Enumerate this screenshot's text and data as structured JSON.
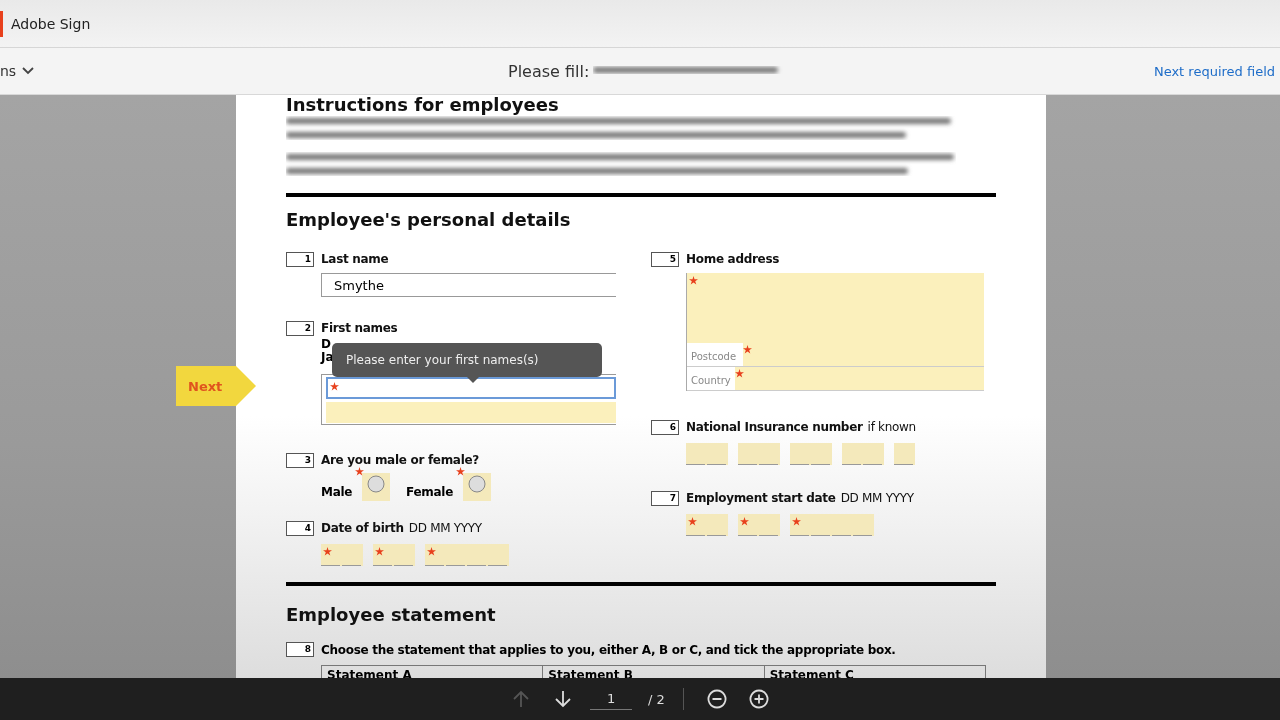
{
  "app": {
    "name": "Adobe Sign"
  },
  "toolbar": {
    "menu_label": "ns",
    "fill_prompt": "Please fill:",
    "next_link": "Next required field"
  },
  "next_tag": {
    "label": "Next"
  },
  "document": {
    "heading_top": "Instructions for employees",
    "section_1": "Employee's personal details",
    "columns": [
      {
        "fields": [
          {
            "number": "1",
            "label": "Last name",
            "kind": "text",
            "value": "Smythe"
          },
          {
            "number": "2",
            "label": "First names",
            "kind": "names",
            "lines": [
              "D",
              "Ja"
            ],
            "focused": true,
            "required": true,
            "tooltip": "Please enter your first names(s)"
          },
          {
            "number": "3",
            "label": "Are you male or female?",
            "kind": "radio",
            "options": [
              {
                "label": "Male",
                "selected": false,
                "required": true
              },
              {
                "label": "Female",
                "selected": false,
                "required": true
              }
            ]
          },
          {
            "number": "4",
            "label": "Date of birth",
            "hint": "DD MM YYYY",
            "kind": "date",
            "required": true
          }
        ]
      },
      {
        "fields": [
          {
            "number": "5",
            "label": "Home address",
            "kind": "address",
            "required": true,
            "subfields": [
              {
                "placeholder": "Postcode",
                "required": true
              },
              {
                "placeholder": "Country",
                "required": true
              }
            ]
          },
          {
            "number": "6",
            "label": "National Insurance number",
            "hint": "if known",
            "kind": "ni"
          },
          {
            "number": "7",
            "label": "Employment start date",
            "hint": "DD MM YYYY",
            "kind": "date",
            "required": true
          }
        ]
      }
    ],
    "section_2": "Employee statement",
    "question": {
      "number": "8",
      "text": "Choose the statement that applies to you, either A, B or C, and tick the appropriate box."
    },
    "statement_columns": [
      "Statement A",
      "Statement B",
      "Statement C"
    ]
  },
  "pager": {
    "page": "1",
    "total": "/ 2",
    "prev_disabled": true
  }
}
